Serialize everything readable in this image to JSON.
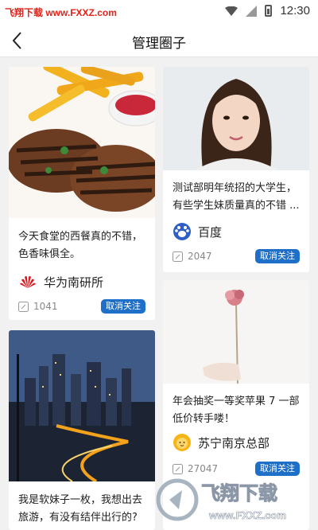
{
  "statusbar": {
    "watermark": "飞翔下载 www.FXXZ.com",
    "time": "12:30"
  },
  "header": {
    "title": "管理圈子"
  },
  "cards": [
    {
      "desc": "今天食堂的西餐真的不错，色香味俱全。",
      "author": "华为南研所",
      "count": "1041",
      "action": "取消关注"
    },
    {
      "desc": "测试部明年统招的大学生，有些学生妹质量真的不错 ...",
      "author": "百度",
      "count": "2047",
      "action": "取消关注"
    },
    {
      "desc": "年会抽奖一等奖苹果 7 一部低价转手喽！",
      "author": "苏宁南京总部",
      "count": "27047",
      "action": "取消关注"
    },
    {
      "desc": "我是软妹子一枚，我想出去旅游，有没有结伴出行的?",
      "author": "",
      "count": "",
      "action": ""
    }
  ],
  "overlay": {
    "watermark_main": "飞翔下载",
    "watermark_url": "www.FXXZ.com"
  },
  "colors": {
    "accent": "#1e6fc8",
    "watermark": "#e0241b"
  }
}
